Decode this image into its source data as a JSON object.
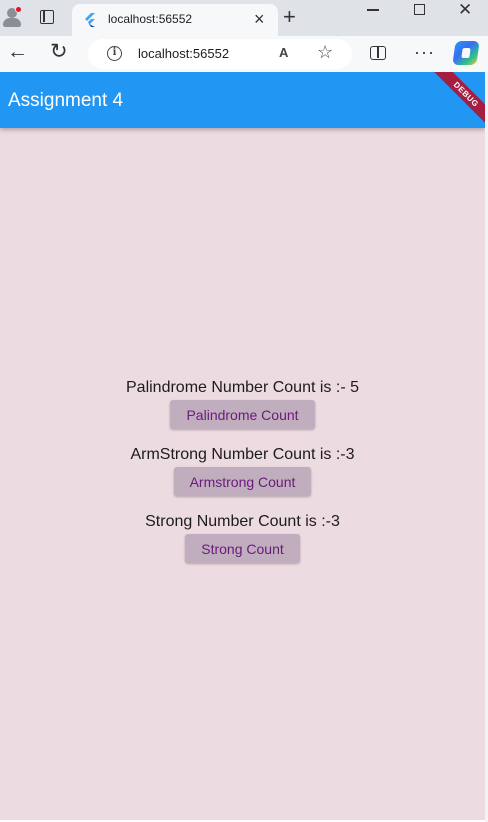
{
  "browser": {
    "tab_title": "localhost:56552",
    "tab_close_glyph": "×",
    "new_tab_glyph": "+",
    "url": "localhost:56552",
    "read_aloud_label": "A",
    "icons": [
      "profile-icon",
      "tab-actions-icon",
      "flutter-favicon",
      "close-icon",
      "new-tab-icon",
      "minimize-icon",
      "maximize-icon",
      "window-close-icon",
      "back-icon",
      "reload-icon",
      "info-icon",
      "read-aloud-icon",
      "favorite-star-icon",
      "split-screen-icon",
      "more-icon",
      "copilot-icon"
    ]
  },
  "app": {
    "title": "Assignment 4",
    "debug_banner": "DEBUG",
    "background_color": "#ecdbe1",
    "appbar_color": "#2196f3",
    "button_color": "#c0aebe",
    "button_text_color": "#6a1b7a",
    "items": [
      {
        "label": "Palindrome Number Count is :- 5",
        "button": "Palindrome Count"
      },
      {
        "label": "ArmStrong Number Count is :-3",
        "button": "Armstrong Count"
      },
      {
        "label": "Strong Number Count is :-3",
        "button": "Strong Count"
      }
    ]
  }
}
